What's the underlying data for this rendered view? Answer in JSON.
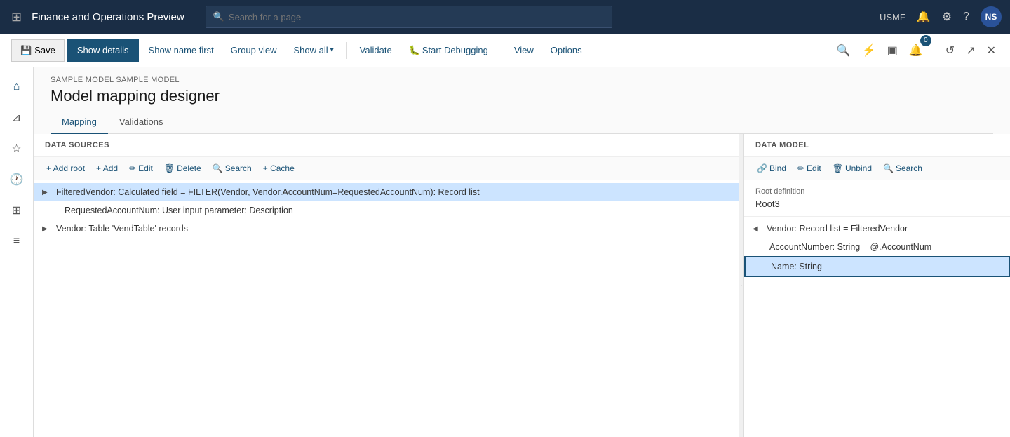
{
  "app": {
    "title": "Finance and Operations Preview",
    "avatar": "NS",
    "org": "USMF"
  },
  "search": {
    "placeholder": "Search for a page"
  },
  "toolbar": {
    "save_label": "Save",
    "show_details_label": "Show details",
    "show_name_first_label": "Show name first",
    "group_view_label": "Group view",
    "show_all_label": "Show all",
    "validate_label": "Validate",
    "start_debugging_label": "Start Debugging",
    "view_label": "View",
    "options_label": "Options",
    "badge_count": "0"
  },
  "page": {
    "breadcrumb": "SAMPLE MODEL SAMPLE MODEL",
    "title": "Model mapping designer",
    "tab_mapping": "Mapping",
    "tab_validations": "Validations"
  },
  "data_sources": {
    "header": "DATA SOURCES",
    "btn_add_root": "+ Add root",
    "btn_add": "+ Add",
    "btn_edit": "Edit",
    "btn_delete": "Delete",
    "btn_search": "Search",
    "btn_cache": "+ Cache",
    "items": [
      {
        "id": "filtered-vendor",
        "text": "FilteredVendor: Calculated field = FILTER(Vendor, Vendor.AccountNum=RequestedAccountNum): Record list",
        "expanded": false,
        "selected": true,
        "indent": 0
      },
      {
        "id": "requested-account",
        "text": "RequestedAccountNum: User input parameter: Description",
        "expanded": false,
        "selected": false,
        "indent": 1
      },
      {
        "id": "vendor",
        "text": "Vendor: Table 'VendTable' records",
        "expanded": false,
        "selected": false,
        "indent": 0
      }
    ]
  },
  "data_model": {
    "header": "DATA MODEL",
    "btn_bind": "Bind",
    "btn_edit": "Edit",
    "btn_unbind": "Unbind",
    "btn_search": "Search",
    "root_def_label": "Root definition",
    "root_def_value": "Root3",
    "items": [
      {
        "id": "vendor-record",
        "text": "Vendor: Record list = FilteredVendor",
        "expanded": true,
        "indent": 0
      },
      {
        "id": "account-number",
        "text": "AccountNumber: String = @.AccountNum",
        "indent": 1,
        "selected": false
      },
      {
        "id": "name-string",
        "text": "Name: String",
        "indent": 1,
        "selected": true
      }
    ]
  }
}
